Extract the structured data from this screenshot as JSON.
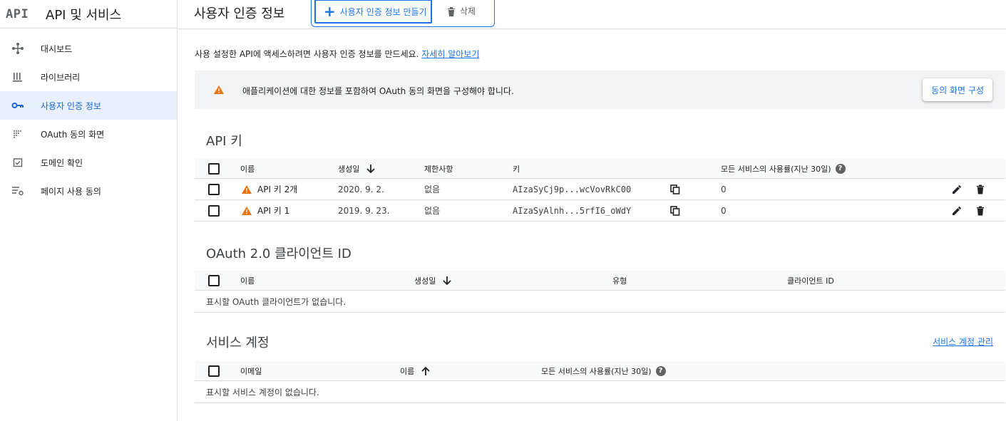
{
  "sidebar": {
    "logo": "API",
    "title": "API 및 서비스",
    "items": [
      {
        "label": "대시보드",
        "icon": "dashboard-icon",
        "active": false
      },
      {
        "label": "라이브러리",
        "icon": "library-icon",
        "active": false
      },
      {
        "label": "사용자 인증 정보",
        "icon": "key-icon",
        "active": true
      },
      {
        "label": "OAuth 동의 화면",
        "icon": "consent-icon",
        "active": false
      },
      {
        "label": "도메인 확인",
        "icon": "domain-check-icon",
        "active": false
      },
      {
        "label": "페이지 사용 동의",
        "icon": "page-settings-icon",
        "active": false
      }
    ]
  },
  "topbar": {
    "title": "사용자 인증 정보",
    "create_label": "사용자 인증 정보 만들기",
    "delete_label": "삭제"
  },
  "intro": {
    "text": "사용 설정한 API에 액세스하려면 사용자 인증 정보를 만드세요.",
    "link": "자세히 알아보기"
  },
  "banner": {
    "text": "애플리케이션에 대한 정보를 포함하여 OAuth 동의 화면을 구성해야 합니다.",
    "button": "동의 화면 구성"
  },
  "api_keys": {
    "title": "API 키",
    "columns": {
      "name": "이름",
      "created": "생성일",
      "restrictions": "제한사항",
      "key": "키",
      "usage": "모든 서비스의 사용률(지난 30일)"
    },
    "rows": [
      {
        "name": "API 키 2개",
        "created": "2020. 9. 2.",
        "restrictions": "없음",
        "key": "AIzaSyCj9p...wcVovRkC00",
        "usage": "0"
      },
      {
        "name": "API 키 1",
        "created": "2019. 9. 23.",
        "restrictions": "없음",
        "key": "AIzaSyAlnh...5rfI6_oWdY",
        "usage": "0"
      }
    ]
  },
  "oauth": {
    "title": "OAuth 2.0 클라이언트 ID",
    "columns": {
      "name": "이름",
      "created": "생성일",
      "type": "유형",
      "client_id": "클라이언트 ID"
    },
    "empty": "표시할 OAuth 클라이언트가 없습니다."
  },
  "service_accounts": {
    "title": "서비스 계정",
    "manage_link": "서비스 계정 관리",
    "columns": {
      "email": "이메일",
      "name": "이름",
      "usage": "모든 서비스의 사용률(지난 30일)"
    },
    "empty": "표시할 서비스 계정이 없습니다."
  },
  "colors": {
    "accent": "#1a73e8",
    "warning": "#e8710a",
    "active_bg": "#e8f0fe"
  }
}
